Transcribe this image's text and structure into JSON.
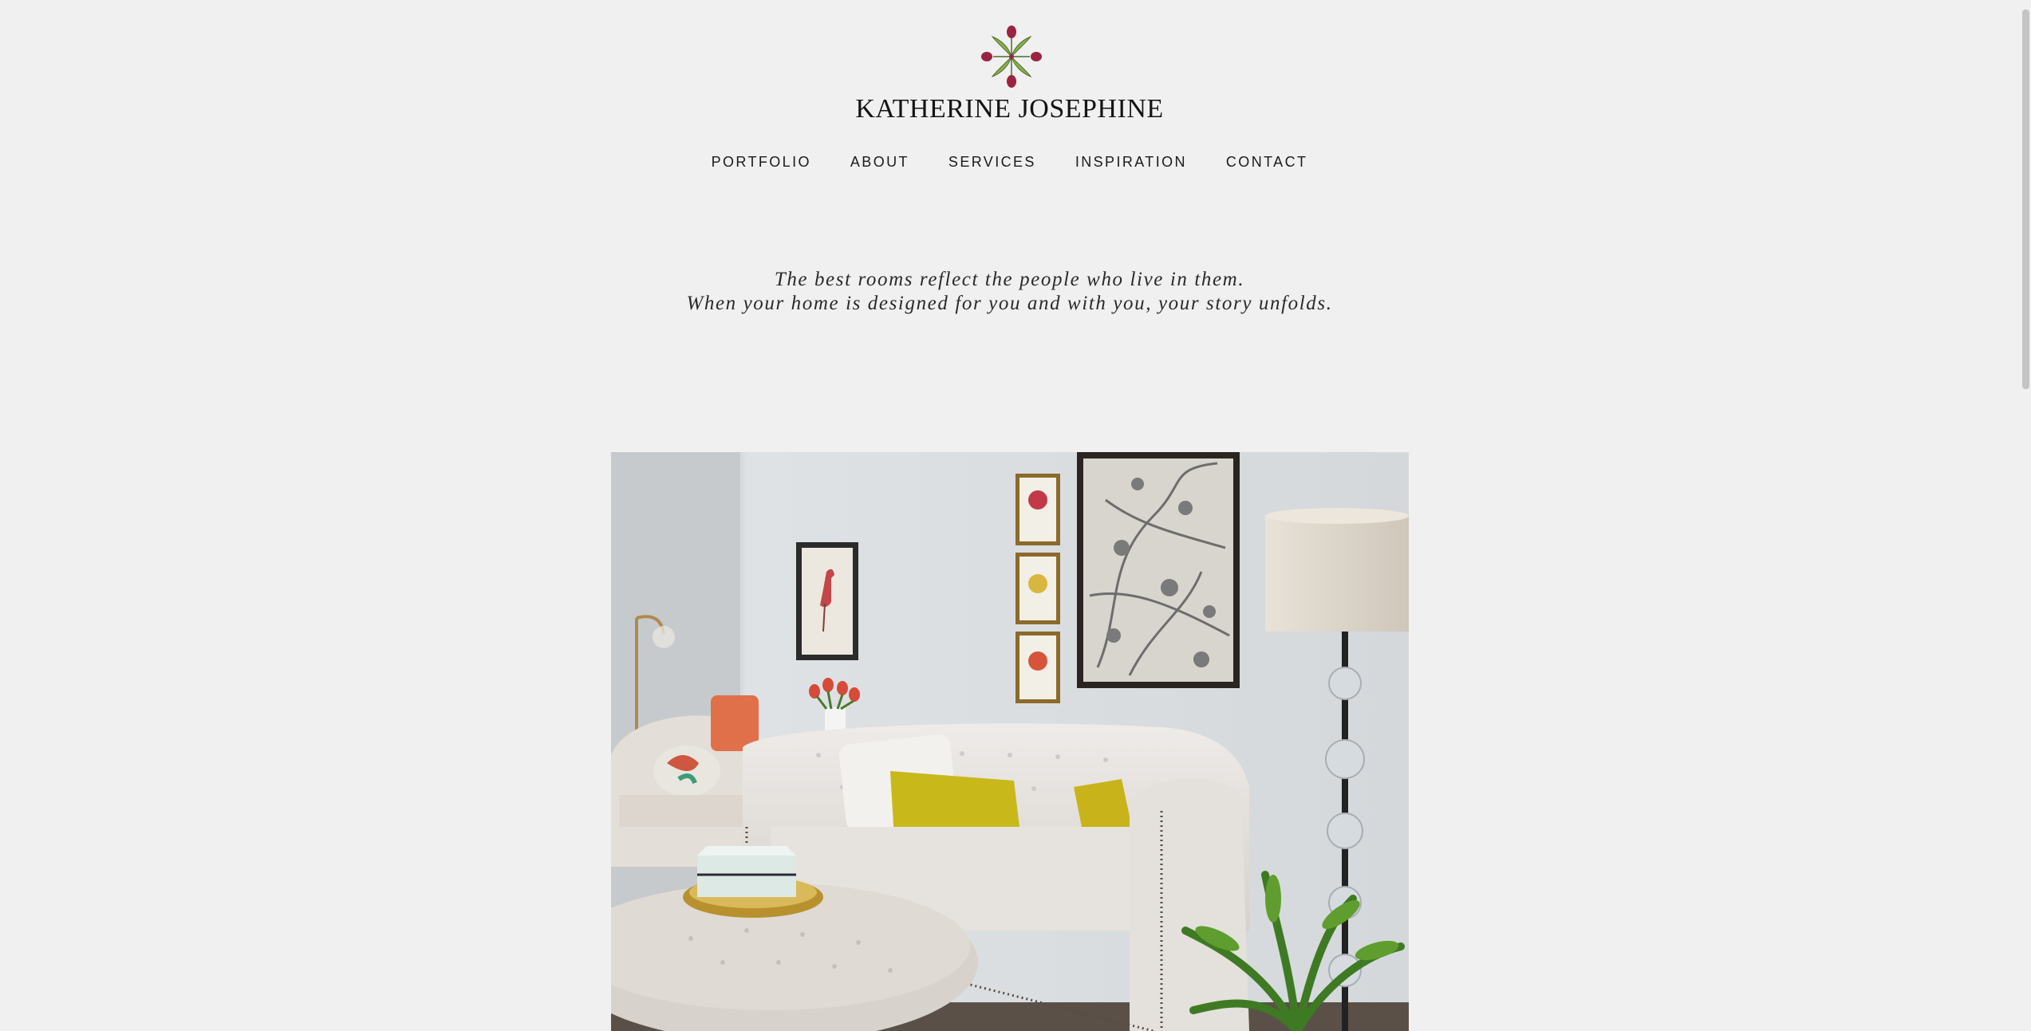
{
  "brand": {
    "name": "KATHERINE JOSEPHINE",
    "logo_icon": "flower-quatrefoil-icon"
  },
  "nav": {
    "items": [
      {
        "label": "PORTFOLIO"
      },
      {
        "label": "ABOUT"
      },
      {
        "label": "SERVICES"
      },
      {
        "label": "INSPIRATION"
      },
      {
        "label": "CONTACT"
      }
    ]
  },
  "tagline": {
    "line1": "The best rooms reflect the people who live in them.",
    "line2": "When your home is designed for you and with you, your story unfolds."
  },
  "colors": {
    "background": "#f0f0f0",
    "logo_petal": "#9c2440",
    "logo_leaf": "#8bb04c"
  }
}
